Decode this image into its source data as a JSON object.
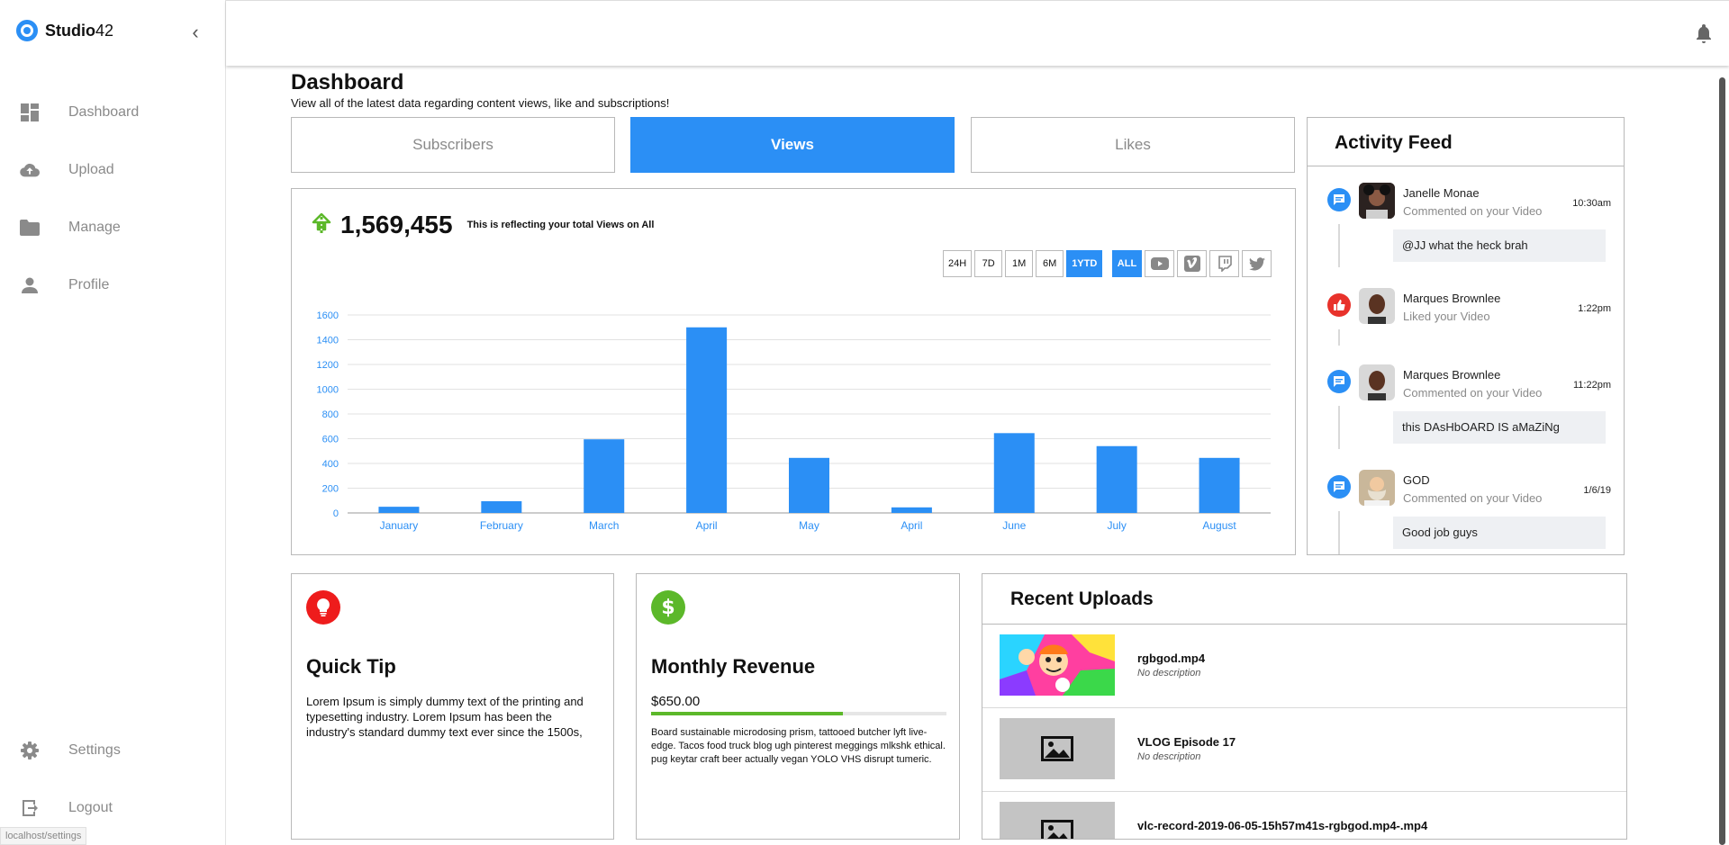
{
  "app": {
    "brand_bold": "Studio",
    "brand_light": "42"
  },
  "sidebar": {
    "items": [
      {
        "label": "Dashboard",
        "icon": "dashboard-icon"
      },
      {
        "label": "Upload",
        "icon": "cloud-upload-icon"
      },
      {
        "label": "Manage",
        "icon": "folder-icon"
      },
      {
        "label": "Profile",
        "icon": "person-icon"
      }
    ],
    "bottom_items": [
      {
        "label": "Settings",
        "icon": "gear-icon"
      },
      {
        "label": "Logout",
        "icon": "logout-icon"
      }
    ]
  },
  "status_bar": {
    "url": "localhost/settings"
  },
  "header": {
    "title": "Dashboard",
    "subtitle": "View all of the latest data regarding content views, like and subscriptions!"
  },
  "tabs": [
    {
      "label": "Subscribers",
      "active": false
    },
    {
      "label": "Views",
      "active": true
    },
    {
      "label": "Likes",
      "active": false
    }
  ],
  "summary": {
    "total": "1,569,455",
    "description": "This is reflecting your total Views on All",
    "ranges": [
      {
        "label": "24H",
        "active": false
      },
      {
        "label": "7D",
        "active": false
      },
      {
        "label": "1M",
        "active": false
      },
      {
        "label": "6M",
        "active": false
      },
      {
        "label": "1YTD",
        "active": true
      }
    ],
    "sources": [
      {
        "label": "ALL",
        "active": true
      },
      {
        "icon": "youtube-icon"
      },
      {
        "icon": "vimeo-icon"
      },
      {
        "icon": "twitch-icon"
      },
      {
        "icon": "twitter-icon"
      }
    ]
  },
  "chart_data": {
    "type": "bar",
    "categories": [
      "January",
      "February",
      "March",
      "April",
      "May",
      "April",
      "June",
      "July",
      "August"
    ],
    "values": [
      50,
      95,
      595,
      1500,
      445,
      45,
      645,
      540,
      445
    ],
    "ylim": [
      0,
      1600
    ],
    "yticks": [
      0,
      200,
      400,
      600,
      800,
      1000,
      1200,
      1400,
      1600
    ],
    "grid": true,
    "colors": {
      "bar": "#2b8ff5",
      "tick": "#2b8ff5"
    }
  },
  "activity_feed": {
    "title": "Activity Feed",
    "items": [
      {
        "name": "Janelle Monae",
        "action": "Commented on your Video",
        "time": "10:30am",
        "comment": "@JJ what the heck brah",
        "badge": "comment-icon"
      },
      {
        "name": "Marques Brownlee",
        "action": "Liked your Video",
        "time": "1:22pm",
        "comment": "",
        "badge": "thumbs-up-icon"
      },
      {
        "name": "Marques Brownlee",
        "action": "Commented on your Video",
        "time": "11:22pm",
        "comment": "this DAsHbOARD IS aMaZiNg",
        "badge": "comment-icon"
      },
      {
        "name": "GOD",
        "action": "Commented on your Video",
        "time": "1/6/19",
        "comment": "Good job guys",
        "badge": "comment-icon"
      }
    ]
  },
  "quick_tip": {
    "title": "Quick Tip",
    "icon": "lightbulb-icon",
    "text": "Lorem Ipsum is simply dummy text of the printing and typesetting industry. Lorem Ipsum has been the industry's standard dummy text ever since the 1500s,"
  },
  "monthly_revenue": {
    "title": "Monthly Revenue",
    "icon": "dollar-icon",
    "amount": "$650.00",
    "progress": 0.65,
    "text": "Board sustainable microdosing prism, tattooed butcher lyft live-edge. Tacos food truck blog ugh pinterest meggings mlkshk ethical. pug keytar craft beer actually vegan YOLO VHS disrupt tumeric."
  },
  "recent_uploads": {
    "title": "Recent Uploads",
    "items": [
      {
        "name": "rgbgod.mp4",
        "description": "No description",
        "thumb": "artwork"
      },
      {
        "name": "VLOG Episode 17",
        "description": "No description",
        "thumb": "placeholder"
      },
      {
        "name": "vlc-record-2019-06-05-15h57m41s-rgbgod.mp4-.mp4",
        "description": "",
        "thumb": "placeholder"
      }
    ]
  }
}
